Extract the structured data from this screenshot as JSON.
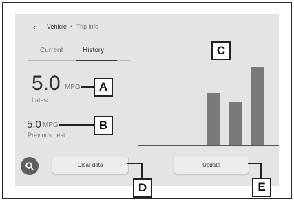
{
  "breadcrumb": {
    "back_glyph": "‹",
    "vehicle": "Vehicle",
    "separator": "•",
    "current_page": "Trip info"
  },
  "tabs": [
    {
      "label": "Current",
      "selected": false
    },
    {
      "label": "History",
      "selected": true
    }
  ],
  "latest": {
    "value": "5.0",
    "unit": "MPG",
    "label": "Latest"
  },
  "previous_best": {
    "value": "5.0",
    "unit": "MPG",
    "label": "Previous best"
  },
  "callouts": {
    "a": "A",
    "b": "B",
    "c": "C",
    "d": "D",
    "e": "E"
  },
  "chart_data": {
    "type": "bar",
    "values": [
      0.67,
      0.55,
      1.0
    ],
    "grid": false
  },
  "buttons": {
    "clear_label": "Clear data",
    "update_label": "Update"
  },
  "icons": {
    "search": "search-icon",
    "back": "back-chevron-icon"
  },
  "colors": {
    "screen_bg": "#e4e4e4",
    "bar": "#7a7a7a",
    "search_button": "#5f5f5f",
    "callout_border": "#222222"
  }
}
